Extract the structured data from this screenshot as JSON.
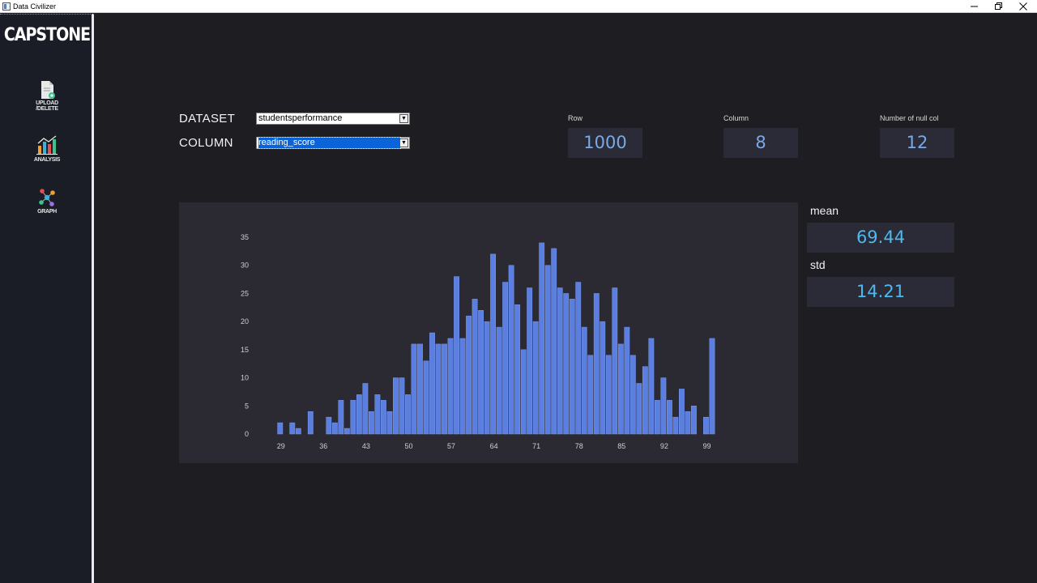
{
  "window": {
    "title": "Data Civilizer",
    "minimize": "—",
    "maximize": "❐",
    "close": "✕"
  },
  "sidebar": {
    "logo": "CAPSTONE",
    "items": [
      {
        "label_line1": "UPLOAD",
        "label_line2": "/DELETE",
        "icon": "upload-file-icon"
      },
      {
        "label_line1": "ANALYSIS",
        "label_line2": "",
        "icon": "bar-chart-icon"
      },
      {
        "label_line1": "GRAPH",
        "label_line2": "",
        "icon": "network-graph-icon"
      }
    ]
  },
  "form": {
    "dataset_label": "DATASET",
    "dataset_value": "studentsperformance",
    "column_label": "COLUMN",
    "column_value": "reading_score"
  },
  "stats": {
    "row_label": "Row",
    "row_value": "1000",
    "column_label": "Column",
    "column_value": "8",
    "null_label": "Number of null col",
    "null_value": "12"
  },
  "metrics": {
    "mean_label": "mean",
    "mean_value": "69.44",
    "std_label": "std",
    "std_value": "14.21"
  },
  "colors": {
    "bar": "#5a7fe0",
    "stat_text": "#79a9e6",
    "metric_text": "#4fb8f0",
    "panel_bg": "#2b2a33"
  },
  "chart_data": {
    "type": "bar",
    "x": [
      29,
      30,
      31,
      32,
      33,
      34,
      35,
      36,
      37,
      38,
      39,
      40,
      41,
      42,
      43,
      44,
      45,
      46,
      47,
      48,
      49,
      50,
      51,
      52,
      53,
      54,
      55,
      56,
      57,
      58,
      59,
      60,
      61,
      62,
      63,
      64,
      65,
      66,
      67,
      68,
      69,
      70,
      71,
      72,
      73,
      74,
      75,
      76,
      77,
      78,
      79,
      80,
      81,
      82,
      83,
      84,
      85,
      86,
      87,
      88,
      89,
      90,
      91,
      92,
      93,
      94,
      95,
      96,
      97,
      98,
      99,
      100
    ],
    "values": [
      2,
      0,
      2,
      1,
      0,
      4,
      0,
      0,
      3,
      2,
      6,
      1,
      6,
      7,
      9,
      4,
      7,
      6,
      4,
      10,
      10,
      7,
      16,
      16,
      13,
      18,
      16,
      16,
      17,
      28,
      17,
      21,
      24,
      22,
      20,
      32,
      19,
      27,
      30,
      23,
      15,
      26,
      20,
      34,
      30,
      33,
      26,
      25,
      24,
      27,
      19,
      14,
      25,
      20,
      14,
      26,
      16,
      19,
      14,
      9,
      12,
      17,
      6,
      10,
      6,
      3,
      8,
      4,
      5,
      0,
      3,
      17
    ],
    "xticks": [
      29,
      36,
      43,
      50,
      57,
      64,
      71,
      78,
      85,
      92,
      99
    ],
    "yticks": [
      0,
      5,
      10,
      15,
      20,
      25,
      30,
      35
    ],
    "ylim": [
      0,
      35
    ],
    "xlim": [
      29,
      100
    ],
    "title": "",
    "xlabel": "",
    "ylabel": "",
    "grid": false,
    "legend": "none"
  }
}
